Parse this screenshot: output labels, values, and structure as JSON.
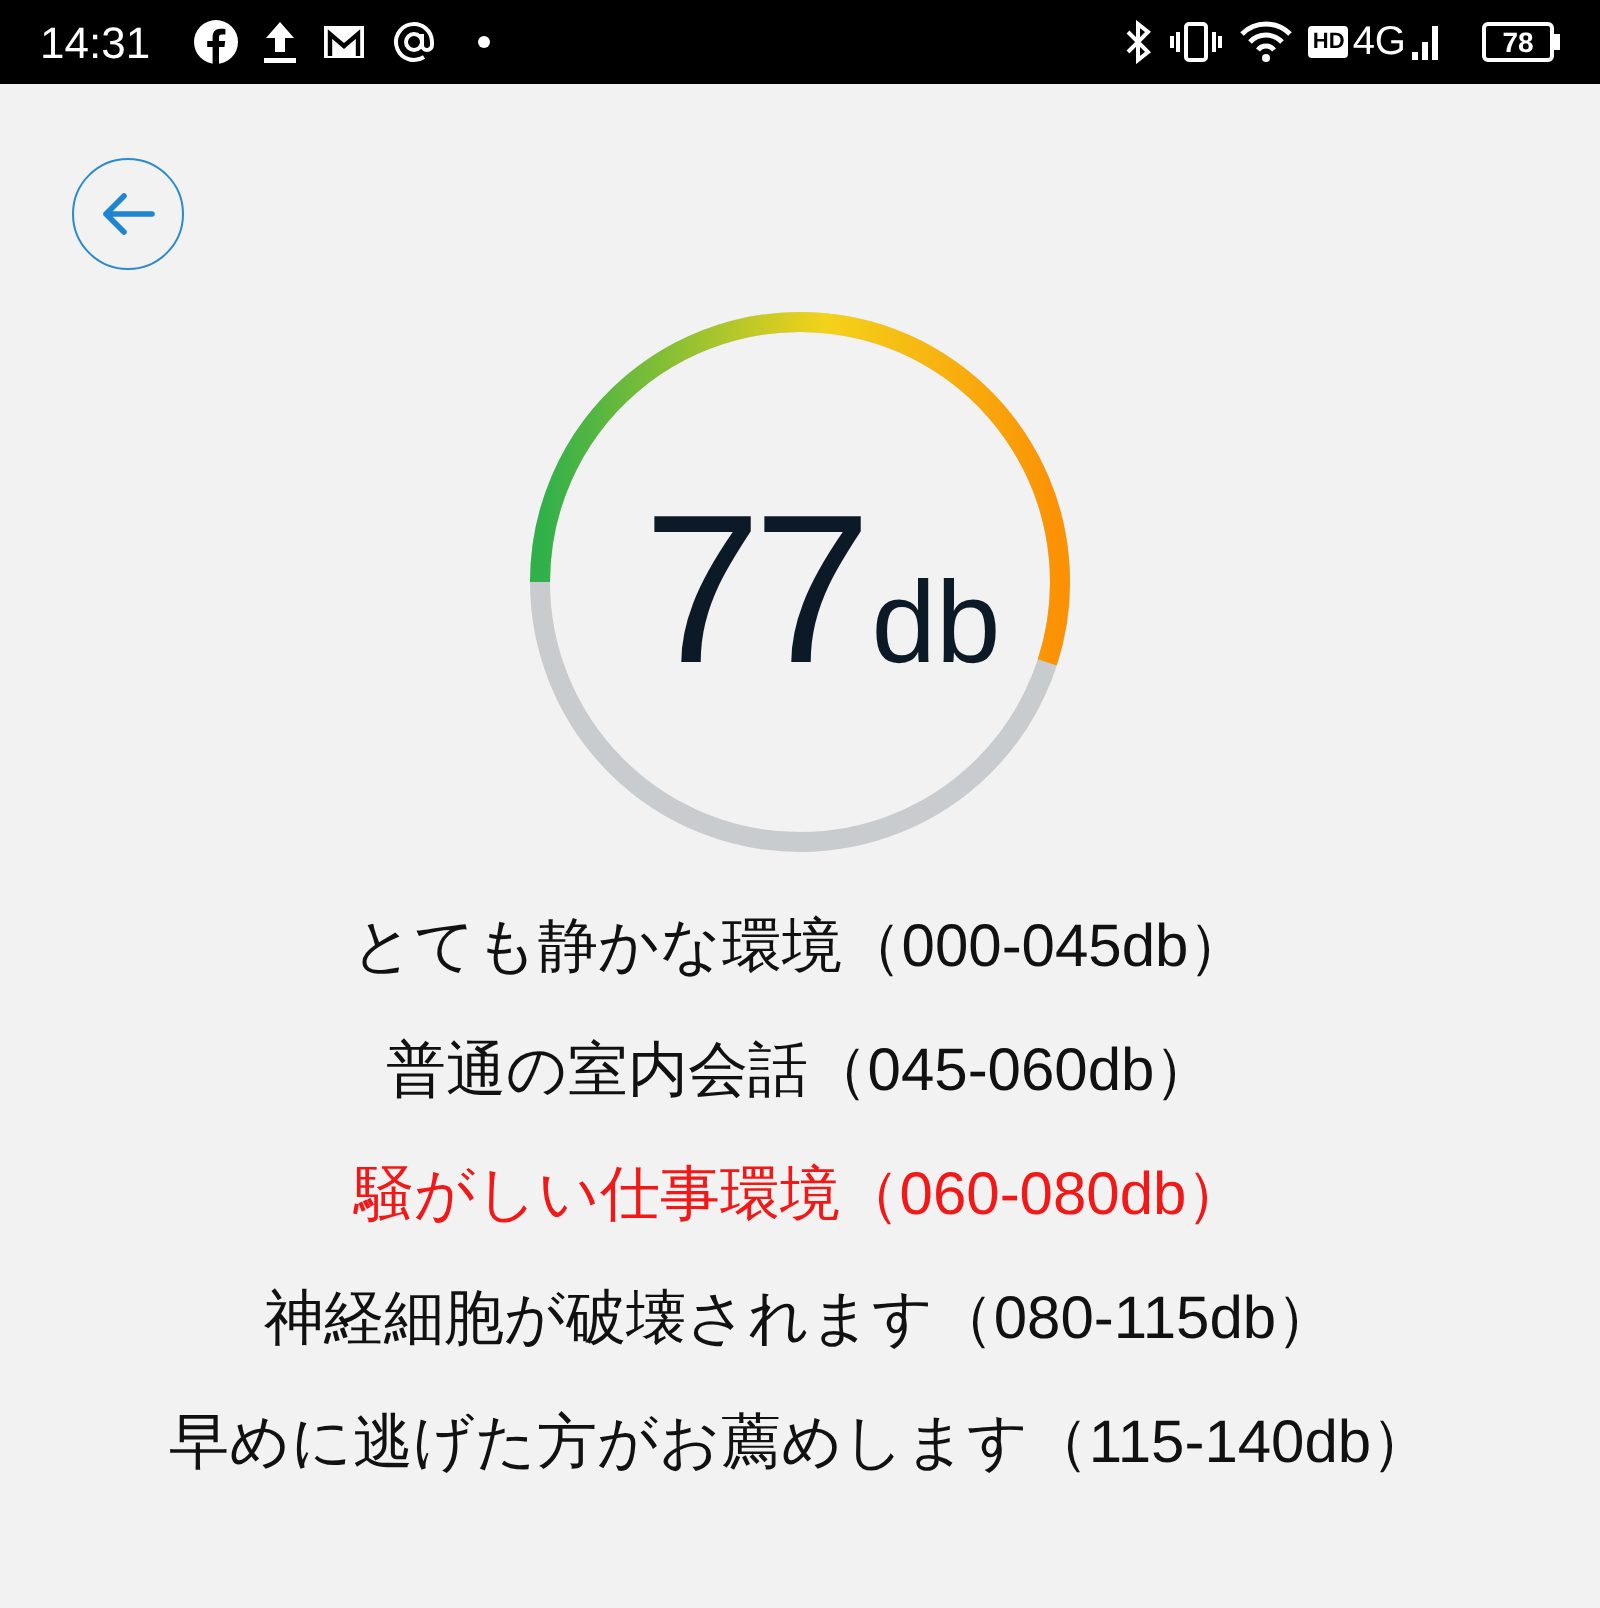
{
  "status_bar": {
    "time": "14:31",
    "hd": "HD",
    "network": "4G",
    "battery": "78"
  },
  "meter": {
    "value": "77",
    "unit": "db"
  },
  "ranges": [
    {
      "label": "とても静かな環境（000-045db）",
      "selected": false
    },
    {
      "label": "普通の室内会話（045-060db）",
      "selected": false
    },
    {
      "label": "騒がしい仕事環境（060-080db）",
      "selected": true
    },
    {
      "label": "神経細胞が破壊されます（080-115db）",
      "selected": false
    },
    {
      "label": "早めに逃げた方がお薦めします（115-140db）",
      "selected": false
    }
  ]
}
